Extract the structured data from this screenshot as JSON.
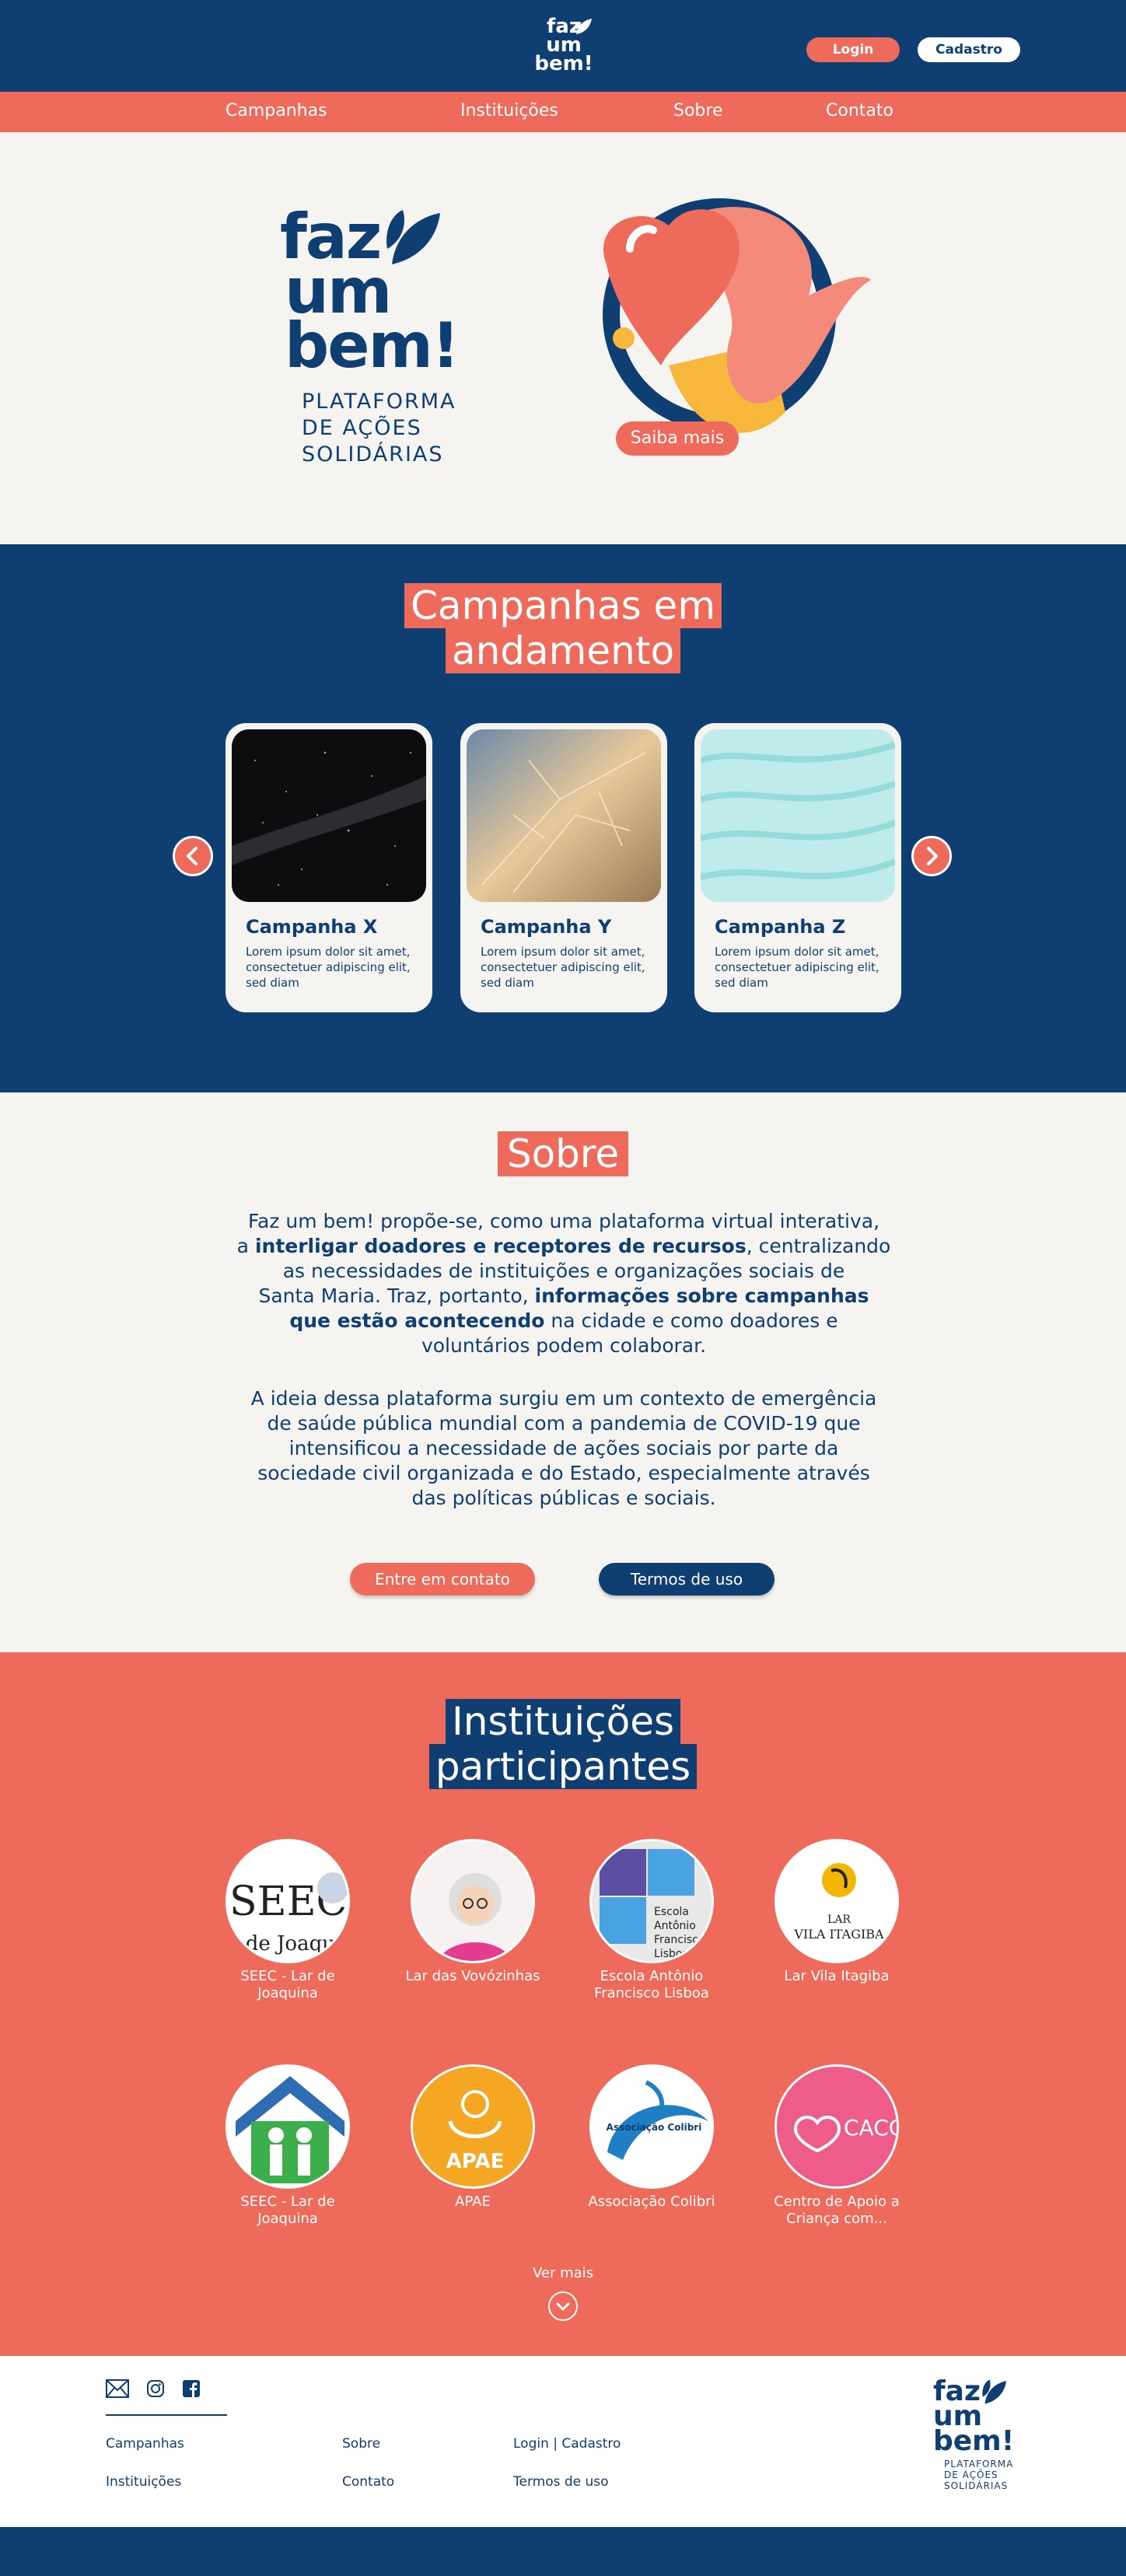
{
  "header": {
    "logo_lines": [
      "faz",
      "um",
      "bem!"
    ],
    "login_label": "Login",
    "cadastro_label": "Cadastro"
  },
  "nav": {
    "items": [
      "Campanhas",
      "Instituições",
      "Sobre",
      "Contato"
    ]
  },
  "hero": {
    "logo_lines": [
      "faz",
      "um",
      "bem!"
    ],
    "tagline_lines": [
      "PLATAFORMA",
      "DE AÇÕES",
      "SOLIDÁRIAS"
    ],
    "cta_label": "Saiba mais"
  },
  "campaigns": {
    "title_lines": [
      "Campanhas em",
      "andamento"
    ],
    "cards": [
      {
        "title": "Campanha X",
        "desc": "Lorem ipsum dolor sit amet, consectetuer adipiscing elit, sed diam"
      },
      {
        "title": "Campanha Y",
        "desc": "Lorem ipsum dolor sit amet, consectetuer adipiscing elit, sed diam"
      },
      {
        "title": "Campanha Z",
        "desc": "Lorem ipsum dolor sit amet, consectetuer adipiscing elit, sed diam"
      }
    ]
  },
  "about": {
    "title": "Sobre",
    "p1": [
      "Faz um bem! propõe-se, como uma plataforma virtual interativa,",
      "a ",
      "interligar doadores e receptores de recursos",
      ", centralizando",
      "as necessidades de instituições e organizações sociais de",
      "Santa Maria. Traz, portanto, ",
      "informações sobre campanhas",
      "que estão acontecendo",
      " na cidade e como doadores e",
      "voluntários podem colaborar."
    ],
    "p2": [
      "A ideia dessa plataforma surgiu em um contexto de emergência",
      "de saúde pública mundial com a pandemia de COVID-19 que",
      "intensificou a necessidade de ações sociais por parte da",
      "sociedade civil organizada e do Estado, especialmente através",
      "das políticas públicas e sociais."
    ],
    "contact_label": "Entre em contato",
    "terms_label": "Termos de uso"
  },
  "institutions": {
    "title_lines": [
      "Instituições",
      "participantes"
    ],
    "orgs": [
      {
        "name": "SEEC - Lar de Joaquina",
        "logo_text": "SEEC"
      },
      {
        "name": "Lar das Vovózinhas",
        "logo_text": ""
      },
      {
        "name": "Escola Antônio Francisco Lisboa",
        "logo_text": "Escola Antônio Francisco Lisboa"
      },
      {
        "name": "Lar Vila Itagiba",
        "logo_text": "LAR VILA ITAGIBA"
      },
      {
        "name": "SEEC - Lar de Joaquina",
        "logo_text": ""
      },
      {
        "name": "APAE",
        "logo_text": "APAE"
      },
      {
        "name": "Associação Colibri",
        "logo_text": "Associação Colibri"
      },
      {
        "name": "Centro de Apoio a Criança com...",
        "logo_text": "CACC"
      }
    ],
    "more_label": "Ver mais"
  },
  "footer": {
    "links": {
      "campanhas": "Campanhas",
      "instituicoes": "Instituições",
      "sobre": "Sobre",
      "contato": "Contato",
      "login_cadastro": "Login | Cadastro",
      "termos": "Termos de uso"
    },
    "icons": [
      "mail-icon",
      "instagram-icon",
      "facebook-icon"
    ],
    "logo_lines": [
      "faz",
      "um",
      "bem!"
    ],
    "tagline_lines": [
      "PLATAFORMA",
      "DE AÇÕES",
      "SOLIDÁRIAS"
    ]
  },
  "colors": {
    "navy": "#0f3e72",
    "coral": "#ee6a5a",
    "cream": "#f6f4f1"
  }
}
